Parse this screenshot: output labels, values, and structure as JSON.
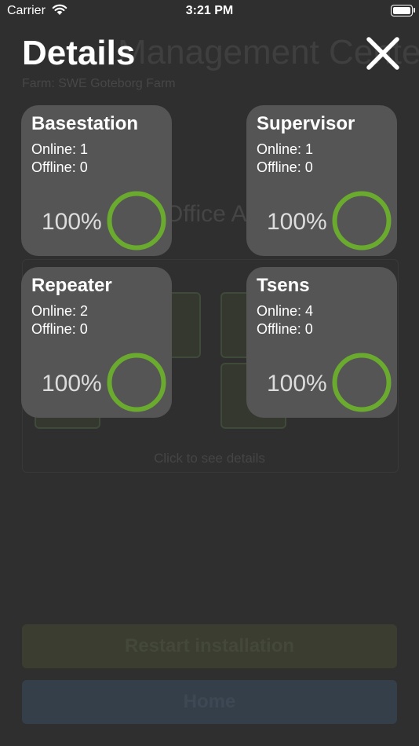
{
  "status_bar": {
    "carrier": "Carrier",
    "time": "3:21 PM"
  },
  "background": {
    "title": "Management Center",
    "farm": "Farm: SWE Goteborg Farm",
    "area": "Office Area",
    "click_hint": "Click to see details",
    "restart_label": "Restart installation",
    "home_label": "Home"
  },
  "header": {
    "title": "Details",
    "close_icon": "close-icon"
  },
  "cards": [
    {
      "title": "Basestation",
      "online": "Online: 1",
      "offline": "Offline: 0",
      "percent": "100%",
      "progress": 1.0
    },
    {
      "title": "Supervisor",
      "online": "Online: 1",
      "offline": "Offline: 0",
      "percent": "100%",
      "progress": 1.0
    },
    {
      "title": "Repeater",
      "online": "Online: 2",
      "offline": "Offline: 0",
      "percent": "100%",
      "progress": 1.0
    },
    {
      "title": "Tsens",
      "online": "Online: 4",
      "offline": "Offline: 0",
      "percent": "100%",
      "progress": 1.0
    }
  ],
  "colors": {
    "ring": "#6aaa2e",
    "card": "#555555",
    "overlay": "#2f2f2f"
  }
}
